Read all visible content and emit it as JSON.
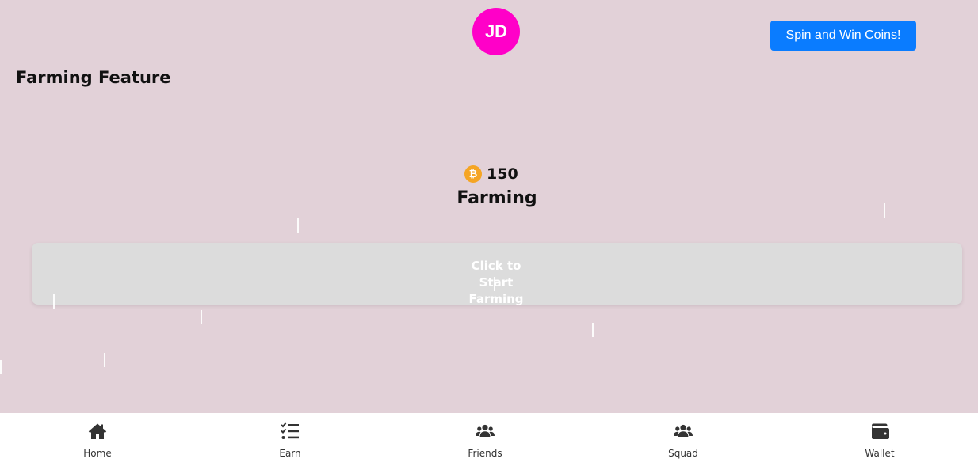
{
  "header": {
    "avatar_initials": "JD",
    "avatar_color": "#ff00c8",
    "spin_button_label": "Spin and Win Coins!",
    "spin_button_color": "#0a7cff"
  },
  "page": {
    "title": "Farming Feature",
    "background_color": "#e2d1d8"
  },
  "farming": {
    "coin_icon": "bitcoin-coin-icon",
    "coin_symbol": "₿",
    "balance": "150",
    "heading": "Farming",
    "start_button_line1": "Click to Start",
    "start_button_line2": "Farming"
  },
  "bottom_nav": {
    "items": [
      {
        "label": "Home",
        "icon": "home-icon"
      },
      {
        "label": "Earn",
        "icon": "task-list-icon"
      },
      {
        "label": "Friends",
        "icon": "users-icon"
      },
      {
        "label": "Squad",
        "icon": "users-icon"
      },
      {
        "label": "Wallet",
        "icon": "wallet-icon"
      }
    ]
  }
}
